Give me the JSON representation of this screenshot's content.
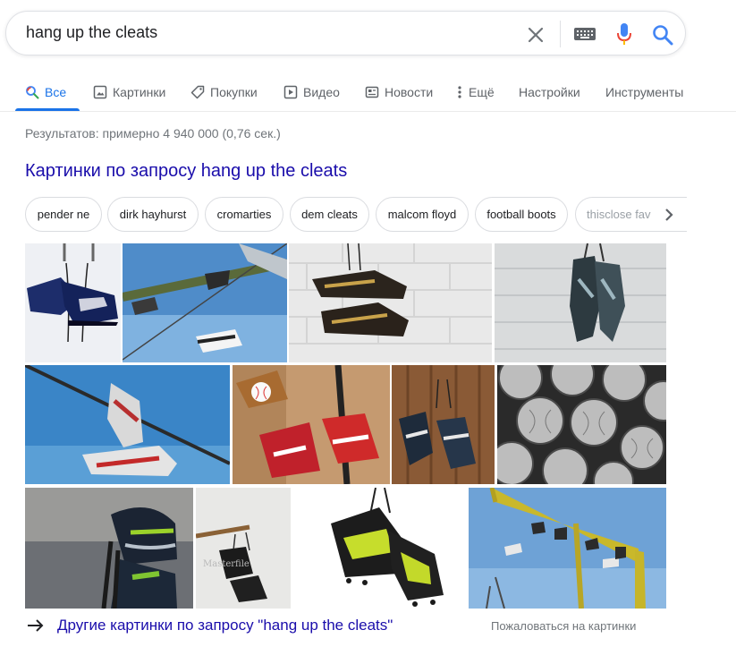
{
  "search": {
    "query": "hang up the cleats"
  },
  "tabs": [
    {
      "label": "Все",
      "icon": "search-icon",
      "active": true
    },
    {
      "label": "Картинки",
      "icon": "image-icon"
    },
    {
      "label": "Покупки",
      "icon": "tag-icon"
    },
    {
      "label": "Видео",
      "icon": "play-icon"
    },
    {
      "label": "Новости",
      "icon": "news-icon"
    },
    {
      "label": "Ещё",
      "icon": "more-vert-icon"
    },
    {
      "label": "Настройки"
    },
    {
      "label": "Инструменты"
    }
  ],
  "stats": "Результатов: примерно 4 940 000 (0,76 сек.)",
  "images": {
    "title": "Картинки по запросу hang up the cleats",
    "chips": [
      "pender ne",
      "dirk hayhurst",
      "cromarties",
      "dem cleats",
      "malcom floyd",
      "football boots",
      "thisclose fav"
    ],
    "watermark": "Masterfile",
    "more_link": "Другие картинки по запросу \"hang up the cleats\"",
    "report": "Пожаловаться на картинки"
  },
  "colors": {
    "link": "#1a0dab",
    "accent": "#1a73e8",
    "muted": "#70757a"
  }
}
